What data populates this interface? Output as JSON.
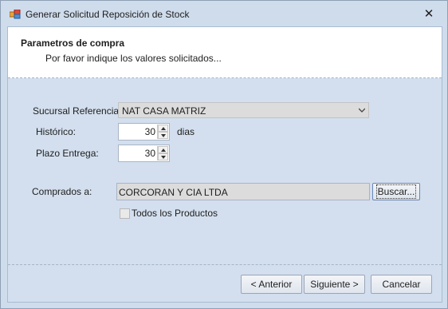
{
  "window": {
    "title": "Generar Solicitud Reposición de Stock",
    "close_symbol": "✕",
    "app_icon": "app-window-icon"
  },
  "header": {
    "title": "Parametros de compra",
    "subtitle": "Por favor indique los valores solicitados..."
  },
  "form": {
    "sucursal_label": "Sucursal Referencia:",
    "sucursal_value": "NAT CASA MATRIZ",
    "historico_label": "Histórico:",
    "historico_value": "30",
    "historico_unit": "dias",
    "plazo_label": "Plazo Entrega:",
    "plazo_value": "30",
    "comprados_label": "Comprados a:",
    "comprados_value": "CORCORAN Y CIA LTDA",
    "buscar_label": "Buscar...",
    "todos_label": "Todos los Productos",
    "todos_checked": false
  },
  "buttons": {
    "anterior": "< Anterior",
    "siguiente": "Siguiente >",
    "cancelar": "Cancelar"
  }
}
